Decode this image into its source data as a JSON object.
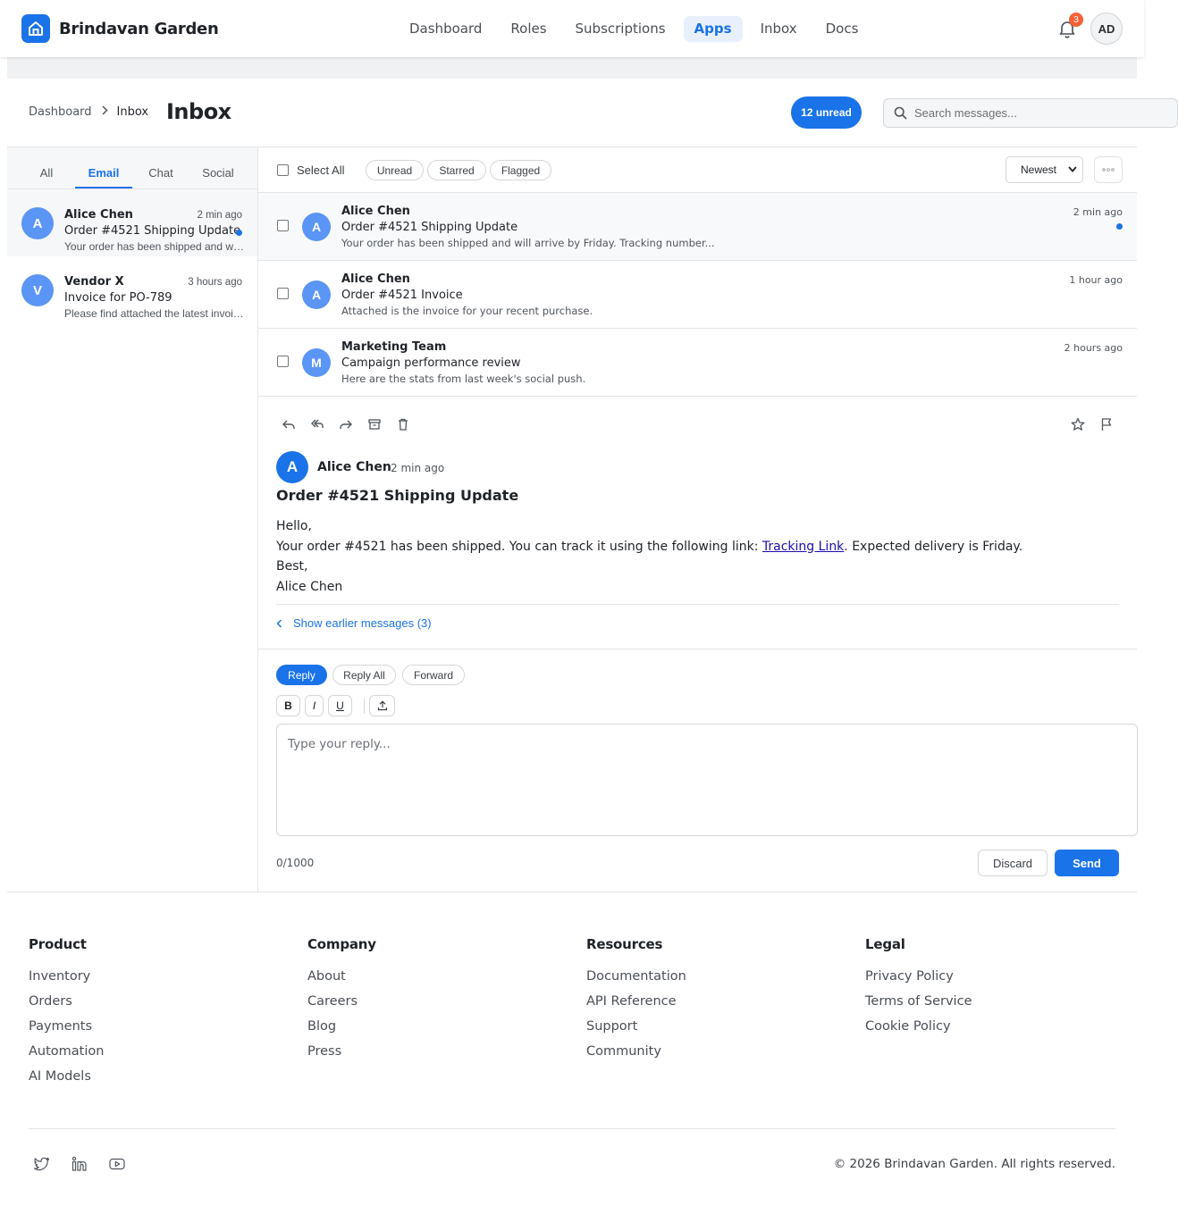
{
  "brand": {
    "name": "Brindavan Garden",
    "accent": "#1a73e8"
  },
  "nav": {
    "items": [
      {
        "label": "Dashboard"
      },
      {
        "label": "Roles"
      },
      {
        "label": "Subscriptions"
      },
      {
        "label": "Apps",
        "active": true
      },
      {
        "label": "Inbox"
      },
      {
        "label": "Docs"
      }
    ],
    "notifications_count": "3",
    "user_initials": "AD"
  },
  "page": {
    "breadcrumb": {
      "parent": "Dashboard",
      "current": "Inbox"
    },
    "title": "Inbox",
    "unread_label": "12 unread",
    "search_placeholder": "Search messages..."
  },
  "sidebar": {
    "tabs": [
      {
        "label": "All"
      },
      {
        "label": "Email",
        "active": true
      },
      {
        "label": "Chat"
      },
      {
        "label": "Social"
      }
    ],
    "conversations": [
      {
        "initial": "A",
        "name": "Alice Chen",
        "time": "2 min ago",
        "subject": "Order #4521 Shipping Update",
        "preview": "Your order has been shipped and will arrive by Friday.",
        "unread": true
      },
      {
        "initial": "V",
        "name": "Vendor X",
        "time": "3 hours ago",
        "subject": "Invoice for PO-789",
        "preview": "Please find attached the latest invoice.",
        "unread": false
      }
    ]
  },
  "toolbar": {
    "select_all": "Select All",
    "filters": [
      "Unread",
      "Starred",
      "Flagged"
    ],
    "sort": "Newest",
    "more_icon": "more-dots-icon"
  },
  "messages": [
    {
      "initial": "A",
      "name": "Alice Chen",
      "subject": "Order #4521 Shipping Update",
      "preview": "Your order has been shipped and will arrive by Friday. Tracking number...",
      "time": "2 min ago",
      "unread": true
    },
    {
      "initial": "A",
      "name": "Alice Chen",
      "subject": "Order #4521 Invoice",
      "preview": "Attached is the invoice for your recent purchase.",
      "time": "1 hour ago",
      "unread": false
    },
    {
      "initial": "M",
      "name": "Marketing Team",
      "subject": "Campaign performance review",
      "preview": "Here are the stats from last week's social push.",
      "time": "2 hours ago",
      "unread": false
    }
  ],
  "reader": {
    "actions": [
      "reply-icon",
      "reply-all-icon",
      "forward-icon",
      "archive-icon",
      "trash-icon",
      "star-icon",
      "flag-icon"
    ],
    "from_initial": "A",
    "from": "Alice Chen",
    "time": "2 min ago",
    "subject": "Order #4521 Shipping Update",
    "greeting": "Hello,",
    "body_before_link": "Your order #4521 has been shipped. You can track it using the following link: ",
    "link_text": "Tracking Link",
    "body_after_link": ". Expected delivery is Friday.",
    "closing": "Best,",
    "signature": "Alice Chen",
    "earlier_label": "Show earlier messages (3)"
  },
  "composer": {
    "modes": [
      {
        "label": "Reply",
        "active": true
      },
      {
        "label": "Reply All"
      },
      {
        "label": "Forward"
      }
    ],
    "format": {
      "bold": "B",
      "italic": "I",
      "underline": "U"
    },
    "placeholder": "Type your reply...",
    "counter": "0/1000",
    "discard": "Discard",
    "send": "Send"
  },
  "footer": {
    "columns": [
      {
        "title": "Product",
        "links": [
          "Inventory",
          "Orders",
          "Payments",
          "Automation",
          "AI Models"
        ]
      },
      {
        "title": "Company",
        "links": [
          "About",
          "Careers",
          "Blog",
          "Press"
        ]
      },
      {
        "title": "Resources",
        "links": [
          "Documentation",
          "API Reference",
          "Support",
          "Community"
        ]
      },
      {
        "title": "Legal",
        "links": [
          "Privacy Policy",
          "Terms of Service",
          "Cookie Policy"
        ]
      }
    ],
    "social": [
      "twitter-icon",
      "linkedin-icon",
      "youtube-icon"
    ],
    "copyright": "© 2026 Brindavan Garden. All rights reserved."
  }
}
